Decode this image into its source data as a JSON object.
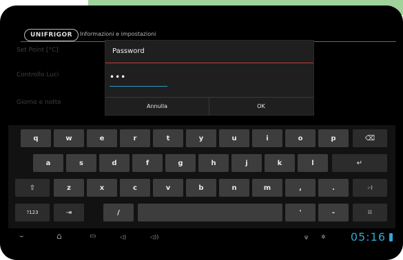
{
  "header": {
    "logo": "UNIFRIGOR",
    "title": "Informazioni e impostazioni"
  },
  "background_labels": {
    "set_point": "Set Point [°C]",
    "controllo_luci": "Controllo Luci",
    "giorno_notte": "Giorno e notte"
  },
  "dialog": {
    "title": "Password",
    "value": "•••",
    "cancel_label": "Annulla",
    "ok_label": "OK"
  },
  "keyboard": {
    "row1": [
      "q",
      "w",
      "e",
      "r",
      "t",
      "y",
      "u",
      "i",
      "o",
      "p"
    ],
    "backspace": "⌫",
    "row2": [
      "a",
      "s",
      "d",
      "f",
      "g",
      "h",
      "j",
      "k",
      "l"
    ],
    "enter": "↵",
    "shift": "⇧",
    "row3": [
      "z",
      "x",
      "c",
      "v",
      "b",
      "n",
      "m",
      ",",
      "."
    ],
    "smiley": ":-)",
    "symbols": "?123",
    "tab": "⇥",
    "slash": "/",
    "apostrophe": "'",
    "dash": "-",
    "settings": "☷"
  },
  "navbar": {
    "back": "⌣",
    "home": "⌂",
    "recents": "▭",
    "vol_down": "◁)",
    "vol_up": "◁))",
    "usb": "ψ",
    "debug": "✲",
    "clock": "05:16"
  },
  "colors": {
    "accent": "#2fa6d6",
    "dialog_divider": "#c63b3b",
    "green_banner": "#9fd39b"
  }
}
